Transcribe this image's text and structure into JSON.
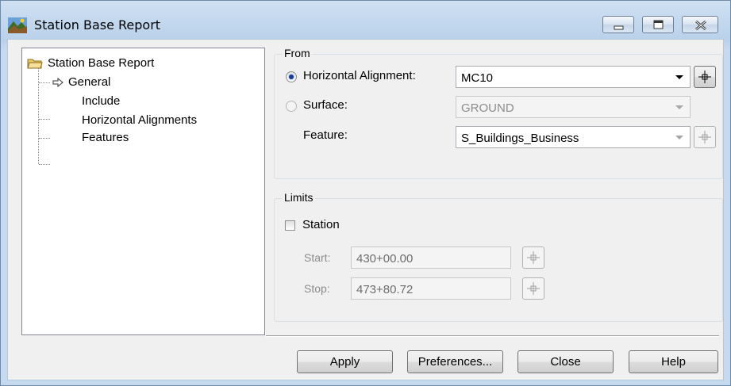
{
  "window": {
    "title": "Station Base Report",
    "controls": [
      "minimize",
      "maximize",
      "close"
    ]
  },
  "tree": {
    "root": "Station Base Report",
    "items": [
      {
        "label": "General",
        "selected": true
      },
      {
        "label": "Include"
      },
      {
        "label": "Horizontal Alignments"
      },
      {
        "label": "Features"
      }
    ]
  },
  "from": {
    "group_label": "From",
    "horizontal_alignment": {
      "label": "Horizontal Alignment:",
      "value": "MC10",
      "selected": true
    },
    "surface": {
      "label": "Surface:",
      "value": "GROUND",
      "enabled": false
    },
    "feature": {
      "label": "Feature:",
      "value": "S_Buildings_Business"
    }
  },
  "limits": {
    "group_label": "Limits",
    "station": {
      "label": "Station",
      "checked": false
    },
    "start": {
      "label": "Start:",
      "value": "430+00.00"
    },
    "stop": {
      "label": "Stop:",
      "value": "473+80.72"
    }
  },
  "buttons": {
    "apply": "Apply",
    "preferences": "Preferences...",
    "close": "Close",
    "help": "Help"
  }
}
